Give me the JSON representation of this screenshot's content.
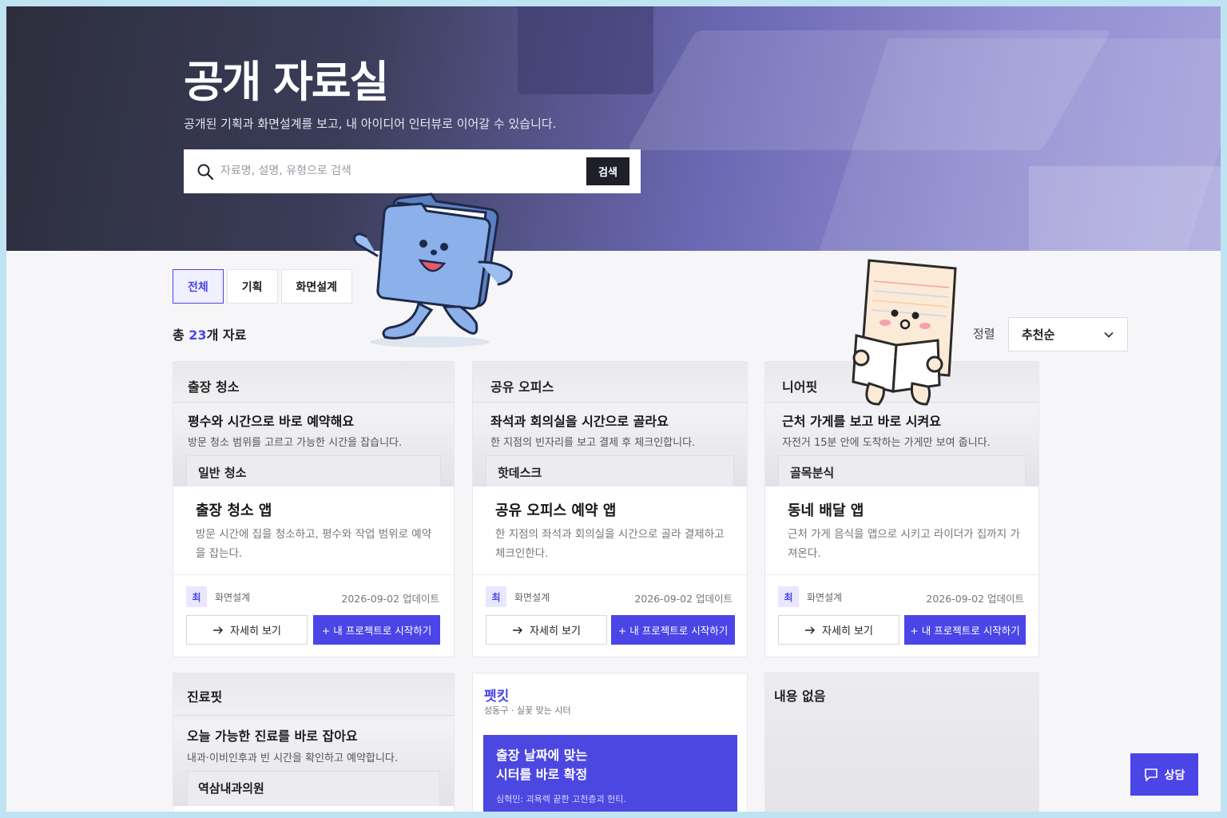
{
  "hero": {
    "title": "공개 자료실",
    "subtitle": "공개된 기획과 화면설계를 보고, 내 아이디어 인터뷰로 이어갈 수 있습니다.",
    "search_placeholder": "자료명, 설명, 유형으로 검색",
    "search_button": "검색"
  },
  "filters": {
    "tabs": [
      "전체",
      "기획",
      "화면설계"
    ],
    "active": "전체"
  },
  "count": {
    "prefix": "총 ",
    "number": "23",
    "suffix": "개 자료"
  },
  "sort": {
    "label": "정렬",
    "selected": "추천순"
  },
  "cards": [
    {
      "preview_brand": "출장 청소",
      "preview_headline": "평수와 시간으로 바로 예약해요",
      "preview_desc": "방문 청소 범위를 고르고 가능한 시간을 잡습니다.",
      "preview_chip": "일반 청소",
      "title": "출장 청소 앱",
      "description": "방문 시간에 집을 청소하고, 평수와 작업 범위로 예약을 잡는다.",
      "avatar": "최",
      "category": "화면설계",
      "date": "2026-09-02 업데이트",
      "detail_button": "자세히 보기",
      "start_button": "+ 내 프로젝트로 시작하기"
    },
    {
      "preview_brand": "공유 오피스",
      "preview_headline": "좌석과 회의실을 시간으로 골라요",
      "preview_desc": "한 지점의 빈자리를 보고 결제 후 체크인합니다.",
      "preview_chip": "핫데스크",
      "title": "공유 오피스 예약 앱",
      "description": "한 지점의 좌석과 회의실을 시간으로 골라 결제하고 체크인한다.",
      "avatar": "최",
      "category": "화면설계",
      "date": "2026-09-02 업데이트",
      "detail_button": "자세히 보기",
      "start_button": "+ 내 프로젝트로 시작하기"
    },
    {
      "preview_brand": "니어핏",
      "preview_headline": "근처 가게를 보고 바로 시켜요",
      "preview_desc": "자전거 15분 안에 도착하는 가게만 보여 줍니다.",
      "preview_chip": "골목분식",
      "title": "동네 배달 앱",
      "description": "근처 가게 음식을 앱으로 시키고 라이더가 집까지 가져온다.",
      "avatar": "최",
      "category": "화면설계",
      "date": "2026-09-02 업데이트",
      "detail_button": "자세히 보기",
      "start_button": "+ 내 프로젝트로 시작하기"
    }
  ],
  "row2": {
    "clinic": {
      "brand": "진료핏",
      "headline": "오늘 가능한 진료를 바로 잡아요",
      "desc": "내과·이비인후과 빈 시간을 확인하고 예약합니다.",
      "chip": "역삼내과의원"
    },
    "petkit": {
      "brand": "펫킷",
      "tagline": "성동구 · 실꽃 맞는 시터",
      "banner_line1": "출장 날짜에 맞는",
      "banner_line2": "시터를 바로 확정",
      "banner_line3": "심혁민: 괴욕렉 끝한 고천층괴 헌티."
    },
    "empty": {
      "text": "내용 없음"
    }
  },
  "chat_button": "상담",
  "colors": {
    "accent": "#4b45e8",
    "dark": "#1e1f29",
    "hero_start": "#2c2e3d",
    "hero_end": "#a6a2dc"
  },
  "icons": [
    "search-icon",
    "chevron-down-icon",
    "arrow-right-icon",
    "chat-icon"
  ]
}
